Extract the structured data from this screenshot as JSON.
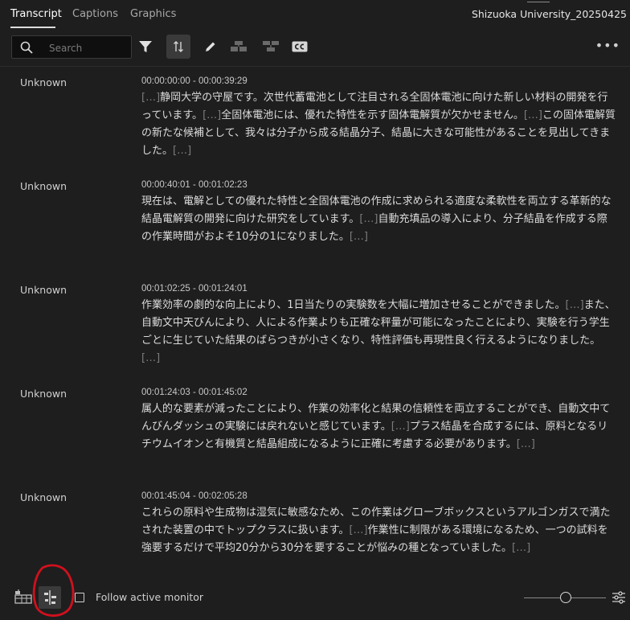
{
  "tabs": [
    {
      "label": "Transcript",
      "active": true
    },
    {
      "label": "Captions",
      "active": false
    },
    {
      "label": "Graphics",
      "active": false
    }
  ],
  "document_title": "Shizuoka University_20250425",
  "toolbar": {
    "search_placeholder": "Search",
    "icons": [
      "search-icon",
      "filter-icon",
      "sync-icon",
      "edit-icon",
      "merge-segments-icon",
      "split-segments-icon",
      "captions-icon",
      "more-icon"
    ],
    "more_label": "•••"
  },
  "segments": [
    {
      "speaker": "Unknown",
      "timecode": "00:00:00:00 - 00:00:39:29",
      "parts": [
        {
          "t": "[…]",
          "gap": true
        },
        {
          "t": "静岡大学の守屋です。次世代蓄電池として注目される全固体電池に向けた新しい材料の開発を行っています。",
          "gap": false
        },
        {
          "t": "[…]",
          "gap": true
        },
        {
          "t": "全固体電池には、優れた特性を示す固体電解質が欠かせません。",
          "gap": false
        },
        {
          "t": "[…]",
          "gap": true
        },
        {
          "t": "この固体電解質の新たな候補として、我々は分子から成る結晶分子、結晶に大きな可能性があることを見出してきました。",
          "gap": false
        },
        {
          "t": "[…]",
          "gap": true
        }
      ]
    },
    {
      "speaker": "Unknown",
      "timecode": "00:00:40:01 - 00:01:02:23",
      "parts": [
        {
          "t": "現在は、電解としての優れた特性と全固体電池の作成に求められる適度な柔軟性を両立する革新的な結晶電解質の開発に向けた研究をしています。",
          "gap": false
        },
        {
          "t": "[…]",
          "gap": true
        },
        {
          "t": "自動充填品の導入により、分子結晶を作成する際の作業時間がおよそ10分の1になりました。",
          "gap": false
        },
        {
          "t": "[…]",
          "gap": true
        }
      ]
    },
    {
      "speaker": "Unknown",
      "timecode": "00:01:02:25 - 00:01:24:01",
      "parts": [
        {
          "t": "作業効率の劇的な向上により、1日当たりの実験数を大幅に増加させることができました。",
          "gap": false
        },
        {
          "t": "[…]",
          "gap": true
        },
        {
          "t": "また、自動文中天びんにより、人による作業よりも正確な秤量が可能になったことにより、実験を行う学生ごとに生じていた結果のばらつきが小さくなり、特性評価も再現性良く行えるようになりました。",
          "gap": false
        },
        {
          "t": "[…]",
          "gap": true
        }
      ]
    },
    {
      "speaker": "Unknown",
      "timecode": "00:01:24:03 - 00:01:45:02",
      "parts": [
        {
          "t": "属人的な要素が減ったことにより、作業の効率化と結果の信頼性を両立することができ、自動文中てんびんダッシュの実験には戻れないと感じています。",
          "gap": false
        },
        {
          "t": "[…]",
          "gap": true
        },
        {
          "t": "プラス結晶を合成するには、原料となるリチウムイオンと有機質と結晶組成になるように正確に考慮する必要があります。",
          "gap": false
        },
        {
          "t": "[…]",
          "gap": true
        }
      ]
    },
    {
      "speaker": "Unknown",
      "timecode": "00:01:45:04 - 00:02:05:28",
      "parts": [
        {
          "t": "これらの原料や生成物は湿気に敏感なため、この作業はグローブボックスというアルゴンガスで満たされた装置の中でトップクラスに扱います。",
          "gap": false
        },
        {
          "t": "[…]",
          "gap": true
        },
        {
          "t": "作業性に制限がある環境になるため、一つの試料を強要するだけで平均20分から30分を要することが悩みの種となっていました。",
          "gap": false
        },
        {
          "t": "[…]",
          "gap": true
        }
      ]
    }
  ],
  "bottom": {
    "follow_label": "Follow active monitor",
    "follow_checked": false,
    "icons": [
      "timeline-icon",
      "align-segments-icon",
      "zoom-slider",
      "settings-sliders-icon"
    ],
    "zoom_level": 0.5
  },
  "colors": {
    "background": "#1e1e1e",
    "text": "#dcdcdc",
    "gap_marker": "#7c7c7c",
    "annotation": "#d0101e"
  }
}
